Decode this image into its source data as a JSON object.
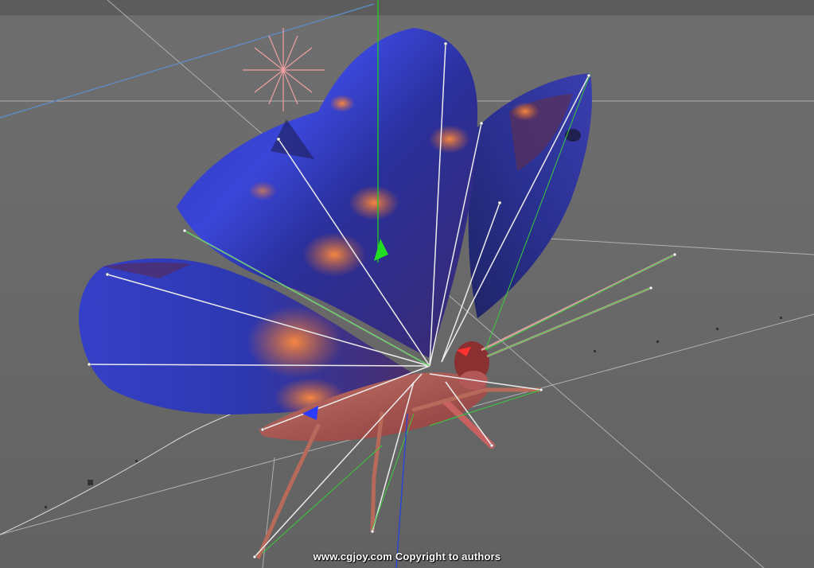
{
  "viewport": {
    "watermark": "www.cgjoy.com Copyright to authors"
  },
  "colors": {
    "background": "#6a6a6a",
    "wing_blue": "#2a3cc8",
    "wing_orange": "#e8783a",
    "body_red": "#b05050",
    "bone_white": "#e8e8e8",
    "axis_green": "#22cc22",
    "axis_blue": "#2244ff",
    "axis_red": "#ff3333"
  }
}
